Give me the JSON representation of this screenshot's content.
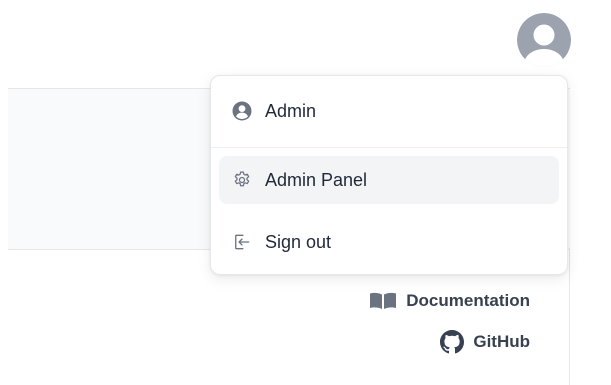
{
  "colors": {
    "text": "#1f2937",
    "icon": "#6b7280",
    "hover_bg": "#f3f4f6",
    "avatar": "#9ca3af"
  },
  "avatar": {
    "icon": "user-avatar-icon"
  },
  "menu": {
    "items": [
      {
        "label": "Admin",
        "icon": "user-circle-icon"
      },
      {
        "label": "Admin Panel",
        "icon": "gear-icon"
      },
      {
        "label": "Sign out",
        "icon": "sign-out-icon"
      }
    ]
  },
  "links": {
    "documentation": {
      "label": "Documentation",
      "icon": "book-icon"
    },
    "github": {
      "label": "GitHub",
      "icon": "github-icon"
    }
  }
}
